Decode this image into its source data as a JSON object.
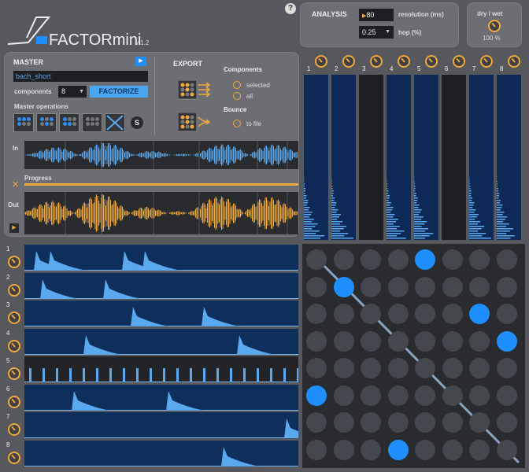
{
  "app": {
    "name": "FACTORmini",
    "version": "v 1.2",
    "help": "?"
  },
  "analysis": {
    "title": "ANALYSIS",
    "resolution_value": "80",
    "resolution_label": "resolution (ms)",
    "hop_value": "0.25",
    "hop_label": "hop (%)"
  },
  "drywet": {
    "label": "dry / wet",
    "value": "100 %"
  },
  "master": {
    "title": "MASTER",
    "file": "bach_short",
    "components_label": "components",
    "components_value": "8",
    "factorize": "FACTORIZE",
    "ops_label": "Master operations",
    "s_button": "S"
  },
  "export": {
    "title": "EXPORT",
    "components_label": "Components",
    "opt_selected": "selected",
    "opt_all": "all",
    "bounce_label": "Bounce",
    "opt_file": "to file"
  },
  "waves": {
    "in_label": "In",
    "progress_label": "Progress",
    "out_label": "Out"
  },
  "columns": [
    "1",
    "2",
    "3",
    "4",
    "5",
    "6",
    "7",
    "8"
  ],
  "lanes": [
    "1",
    "2",
    "3",
    "4",
    "5",
    "6",
    "7",
    "8"
  ],
  "colors": {
    "accent": "#f0a93c",
    "blue": "#1f8eff",
    "wave_in": "#5aa9ee",
    "wave_out": "#f0a93c"
  }
}
